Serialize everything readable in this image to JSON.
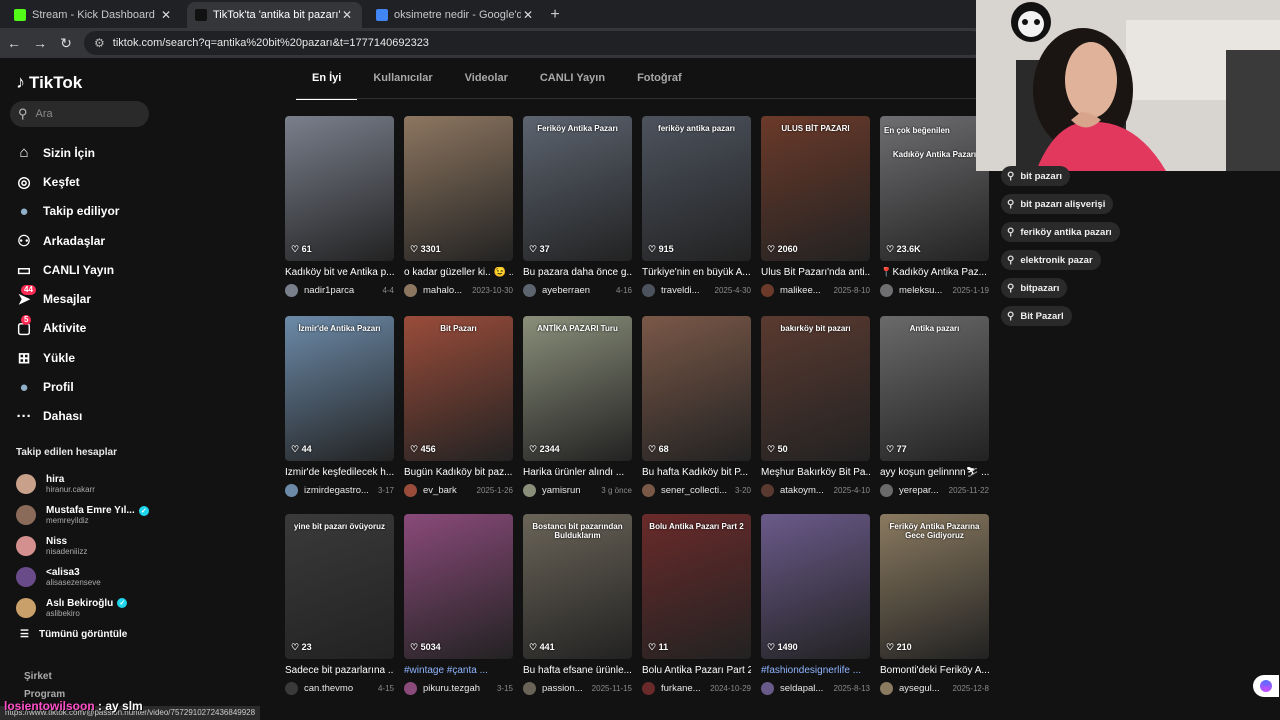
{
  "browser": {
    "tabs": [
      {
        "title": "Stream - Kick Dashboard",
        "color": "#53fc18",
        "active": false
      },
      {
        "title": "TikTok'ta 'antika bit pazarı' bul…",
        "color": "#111111",
        "active": true
      },
      {
        "title": "oksimetre nedir - Google'da Ar…",
        "color": "#4285f4",
        "active": false
      }
    ],
    "url": "tiktok.com/search?q=antika%20bit%20pazarı&t=1777140692323"
  },
  "sidebar": {
    "logo": "TikTok",
    "search_placeholder": "Ara",
    "nav": [
      {
        "label": "Sizin İçin",
        "icon": "home-icon",
        "glyph": "⌂"
      },
      {
        "label": "Keşfet",
        "icon": "compass-icon",
        "glyph": "◎"
      },
      {
        "label": "Takip ediliyor",
        "icon": "following-avatar-icon",
        "glyph": "●"
      },
      {
        "label": "Arkadaşlar",
        "icon": "friends-icon",
        "glyph": "⚇"
      },
      {
        "label": "CANLI Yayın",
        "icon": "live-icon",
        "glyph": "▭"
      },
      {
        "label": "Mesajlar",
        "icon": "messages-icon",
        "glyph": "➤",
        "badge": "44"
      },
      {
        "label": "Aktivite",
        "icon": "activity-icon",
        "glyph": "▢",
        "badge": "5"
      },
      {
        "label": "Yükle",
        "icon": "upload-icon",
        "glyph": "⊞"
      },
      {
        "label": "Profil",
        "icon": "profile-avatar-icon",
        "glyph": "●"
      },
      {
        "label": "Dahası",
        "icon": "more-icon",
        "glyph": "···"
      }
    ],
    "following_title": "Takip edilen hesaplar",
    "following": [
      {
        "name": "hira",
        "handle": "hiranur.cakarr",
        "color": "#c9a08a",
        "verified": false
      },
      {
        "name": "Mustafa Emre Yıl...",
        "handle": "memreyildiz",
        "color": "#8a6b5a",
        "verified": true
      },
      {
        "name": "Niss",
        "handle": "nisadeniiizz",
        "color": "#d48f8f",
        "verified": false
      },
      {
        "name": "<alisa3",
        "handle": "alisasezenseve",
        "color": "#6a4b8a",
        "verified": false
      },
      {
        "name": "Aslı Bekiroğlu",
        "handle": "aslibekiro",
        "color": "#caa06a",
        "verified": true
      }
    ],
    "see_all": "Tümünü görüntüle",
    "footer": [
      "Şirket",
      "Program"
    ]
  },
  "search_tabs": [
    "En İyi",
    "Kullanıcılar",
    "Videolar",
    "CANLI Yayın",
    "Fotoğraf"
  ],
  "videos": [
    {
      "likes": "61",
      "desc": "Kadıköy bit ve Antika p...",
      "user": "nadir1parca",
      "date": "4-4",
      "thumb": "#7a7f8c",
      "overlay": ""
    },
    {
      "likes": "3301",
      "desc": "o kadar güzeller ki.. 😉 ...",
      "user": "mahalo...",
      "date": "2023-10-30",
      "thumb": "#8d7660",
      "overlay": ""
    },
    {
      "likes": "37",
      "desc": "Bu pazara daha önce g...",
      "user": "ayeberraen",
      "date": "4-16",
      "thumb": "#5c6470",
      "overlay": "Feriköy Antika Pazarı"
    },
    {
      "likes": "915",
      "desc": "Türkiye'nin en büyük A...",
      "user": "traveldi...",
      "date": "2025-4-30",
      "thumb": "#4d535e",
      "overlay": "feriköy antika pazarı"
    },
    {
      "likes": "2060",
      "desc": "Ulus Bit Pazarı'nda anti...",
      "user": "malikee...",
      "date": "2025-8-10",
      "thumb": "#6b3a2a",
      "overlay": "ULUS BİT PAZARI"
    },
    {
      "likes": "23.6K",
      "desc": "📍Kadıköy Antika Paz...",
      "user": "meleksu...",
      "date": "2025-1-19",
      "thumb": "#6f6f72",
      "overlay": "Kadıköy Antika Pazarı",
      "tag": "En çok beğenilen"
    },
    {
      "likes": "44",
      "desc": "İzmir'de keşfedilecek h...",
      "user": "izmirdegastro...",
      "date": "3-17",
      "thumb": "#6c8aa8",
      "overlay": "İzmir'de Antika Pazarı"
    },
    {
      "likes": "456",
      "desc": "Bugün Kadıköy bit paz...",
      "user": "ev_bark",
      "date": "2025-1-26",
      "thumb": "#9a4c3a",
      "overlay": "Bit Pazarı"
    },
    {
      "likes": "2344",
      "desc": "Harika ürünler alındı ...",
      "user": "yamisrun",
      "date": "3 g önce",
      "thumb": "#8a8f7a",
      "overlay": "ANTİKA PAZARI Turu"
    },
    {
      "likes": "68",
      "desc": "Bu hafta Kadıköy bit P...",
      "user": "sener_collecti...",
      "date": "3-20",
      "thumb": "#7a5848",
      "overlay": ""
    },
    {
      "likes": "50",
      "desc": "Meşhur Bakırköy Bit Pa...",
      "user": "atakoym...",
      "date": "2025-4-10",
      "thumb": "#5a3a30",
      "overlay": "bakırköy bit pazarı"
    },
    {
      "likes": "77",
      "desc": "ayy koşun gelinnnn⛷ ...",
      "user": "yerepar...",
      "date": "2025-11-22",
      "thumb": "#6a6a6a",
      "overlay": "Antika pazarı"
    },
    {
      "likes": "23",
      "desc": "Sadece bit pazarlarına ...",
      "user": "can.thevmo",
      "date": "4-15",
      "thumb": "#3a3a3a",
      "overlay": "yine bit pazarı övüyoruz"
    },
    {
      "likes": "5034",
      "desc": "#wintage #çanta ...",
      "user": "pikuru.tezgah",
      "date": "3-15",
      "thumb": "#8a4a7a",
      "overlay": "",
      "tag_desc": true
    },
    {
      "likes": "441",
      "desc": "Bu hafta efsane ürünle...",
      "user": "passion...",
      "date": "2025-11-15",
      "thumb": "#6a6458",
      "overlay": "Bostancı bit pazarından Bulduklarım"
    },
    {
      "likes": "11",
      "desc": "Bolu Antika Pazarı Part 2",
      "user": "furkane...",
      "date": "2024-10-29",
      "thumb": "#6a2a2a",
      "overlay": "Bolu Antika Pazarı Part 2"
    },
    {
      "likes": "1490",
      "desc": "#fashiondesignerlife ...",
      "user": "seldapal...",
      "date": "2025-8-13",
      "thumb": "#6a5a8a",
      "overlay": "",
      "tag_desc": true
    },
    {
      "likes": "210",
      "desc": "Bomonti'deki Feriköy A...",
      "user": "aysegul...",
      "date": "2025-12-8",
      "thumb": "#8a7a60",
      "overlay": "Feriköy Antika Pazarına Gece Gidiyoruz"
    }
  ],
  "related_searches": [
    "bit pazarı",
    "bit pazarı alişverişi",
    "feriköy antika pazarı",
    "elektronik pazar",
    "bitpazarı",
    "Bit Pazarl"
  ],
  "status_url": "https://www.tiktok.com/@passion.hunter/video/7572910272436849928",
  "stream_overlay": {
    "name": "losientowilsoon",
    "text": ": ay slm"
  }
}
